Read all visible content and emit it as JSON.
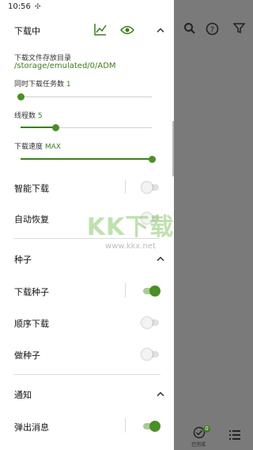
{
  "status": {
    "time": "10:56"
  },
  "downloading": {
    "title": "下载中",
    "storage_label": "下载文件存放目录",
    "storage_path": "/storage/emulated/0/ADM",
    "concurrent_label": "同时下载任务数",
    "concurrent_value": "1",
    "concurrent_level": 0.0,
    "threads_label": "线程数",
    "threads_value": "5",
    "threads_level": 0.27,
    "speed_label": "下载速度",
    "speed_value": "MAX",
    "speed_level": 1.0,
    "smart_download": "智能下载",
    "smart_download_on": false,
    "auto_resume": "自动恢复",
    "auto_resume_on": false
  },
  "seeds": {
    "title": "种子",
    "download_seed": "下载种子",
    "download_seed_on": true,
    "sequential": "顺序下载",
    "sequential_on": false,
    "seeding": "做种子",
    "seeding_on": false
  },
  "notify": {
    "title": "通知",
    "popup": "弹出消息",
    "popup_on": true
  },
  "bottom": {
    "completed_label": "已完成",
    "completed_count": "0"
  },
  "watermark": {
    "logo": "KK下载",
    "url": "www.kkx.net"
  },
  "colors": {
    "accent": "#3c7d1e",
    "scrim": "#7a7a7a"
  },
  "icons": [
    "chart-icon",
    "eye-icon",
    "chevron-up-icon",
    "search-icon",
    "help-icon",
    "filter-icon",
    "check-circle-icon",
    "list-icon"
  ]
}
